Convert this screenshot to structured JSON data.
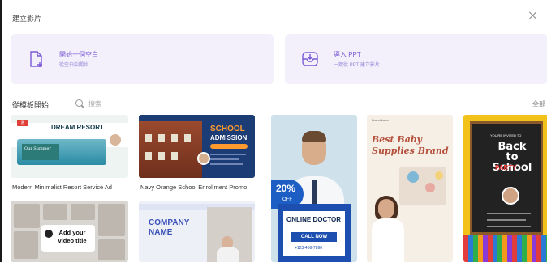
{
  "dialog": {
    "title": "建立影片"
  },
  "start_blank": {
    "title": "開始一個空白",
    "subtitle": "從空白中開始"
  },
  "import_ppt": {
    "title": "導入 PPT",
    "subtitle": "一鍵從 PPT 建立影片！"
  },
  "templates_section": {
    "title": "從模板開始",
    "search_label": "搜索",
    "all_link": "全部"
  },
  "templates": [
    {
      "caption": "Modern Minimalist Resort Service Ad",
      "headline": "DREAM RESORT",
      "badge": "熱",
      "script_text": "Our Summer"
    },
    {
      "caption": "Navy Orange School Enrollment Promo",
      "headline": "SCHOOL",
      "subheadline": "ADMISSION"
    },
    {
      "headline": "ONLINE DOCTOR",
      "button": "CALL NOW",
      "discount": "20%",
      "discount_suffix": "OFF",
      "phone": "+123-456-7890"
    },
    {
      "headline": "Best Baby Supplies Brand",
      "brand": "BrandName"
    },
    {
      "headline_line1": "Back to",
      "headline_line2": "School",
      "subheadline": "PARTY",
      "invite": "YOU'RE INVITED TO"
    },
    {
      "headline": "Add your video title"
    },
    {
      "headline_line1": "COMPANY",
      "headline_line2": "NAME"
    }
  ],
  "colors": {
    "accent": "#7b5ad6",
    "card_bg": "#f3f0fb"
  },
  "icons": {
    "blank": "file-plus-icon",
    "ppt": "import-tray-icon",
    "search": "search-icon",
    "close": "close-icon"
  }
}
